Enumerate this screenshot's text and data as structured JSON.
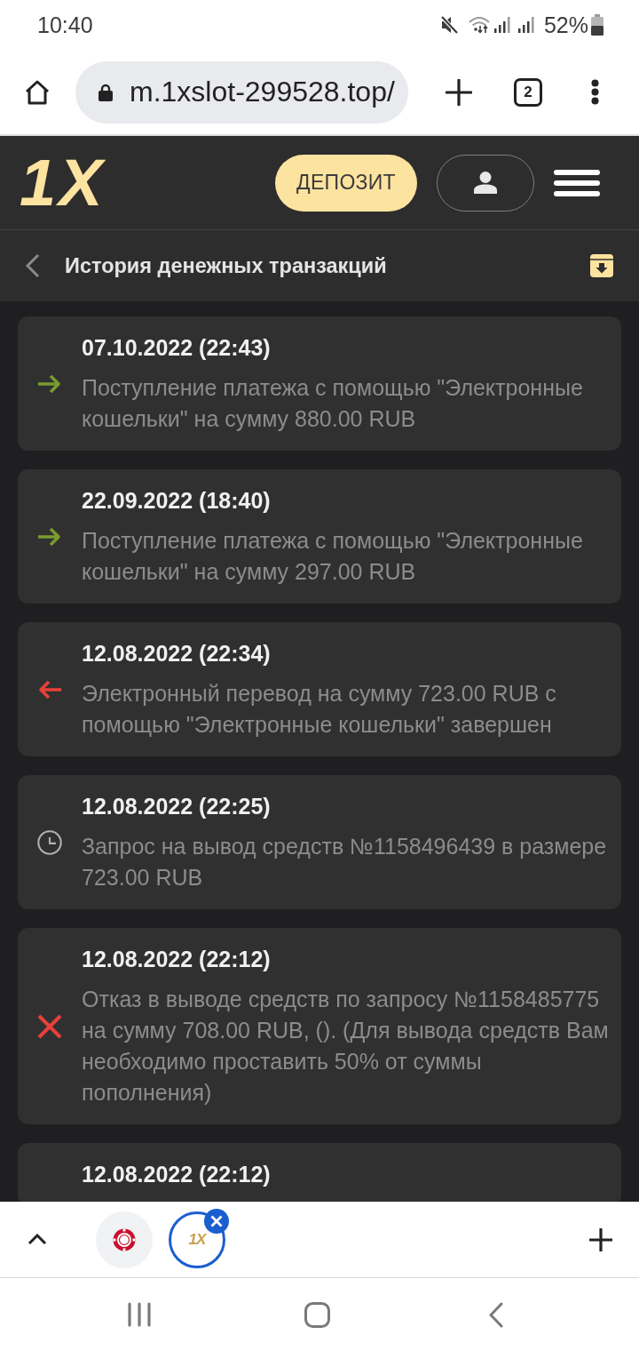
{
  "status_bar": {
    "time": "10:40",
    "battery_percent": "52%"
  },
  "browser_toolbar": {
    "url": "m.1xslot-299528.top/",
    "tab_count": "2"
  },
  "site_header": {
    "logo": "1X",
    "deposit_button": "ДЕПОЗИТ"
  },
  "page_header": {
    "title": "История денежных транзакций"
  },
  "transactions": [
    {
      "kind": "incoming",
      "date": "07.10.2022 (22:43)",
      "text": "Поступление платежа с помощью \"Электронные кошельки\" на сумму 880.00 RUB"
    },
    {
      "kind": "incoming",
      "date": "22.09.2022 (18:40)",
      "text": "Поступление платежа с помощью \"Электронные кошельки\" на сумму 297.00 RUB"
    },
    {
      "kind": "outgoing",
      "date": "12.08.2022 (22:34)",
      "text": "Электронный перевод на сумму 723.00 RUB с помощью \"Электронные кошельки\" завершен"
    },
    {
      "kind": "pending",
      "date": "12.08.2022 (22:25)",
      "text": "Запрос на вывод средств №1158496439 в размере 723.00 RUB"
    },
    {
      "kind": "rejected",
      "date": "12.08.2022 (22:12)",
      "text": "Отказ в выводе средств по запросу №1158485775 на сумму 708.00 RUB, (). (Для вывода средств Вам необходимо проставить 50% от суммы пополнения)"
    },
    {
      "date": "12.08.2022 (22:12)"
    }
  ],
  "tab_strip": {
    "tabs": [
      {
        "kind": "chip",
        "selected": false
      },
      {
        "kind": "logo",
        "label": "1X",
        "selected": true
      }
    ]
  }
}
